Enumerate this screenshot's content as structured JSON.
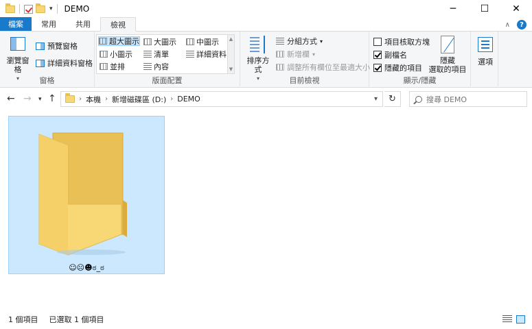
{
  "window": {
    "title": "DEMO",
    "controls": {
      "minimize": "─",
      "maximize": "☐",
      "close": "✕"
    }
  },
  "tabs": [
    {
      "label": "檔案",
      "kind": "file"
    },
    {
      "label": "常用",
      "kind": "normal"
    },
    {
      "label": "共用",
      "kind": "normal"
    },
    {
      "label": "檢視",
      "kind": "active"
    }
  ],
  "ribbon": {
    "panes": {
      "label": "窗格",
      "nav_pane": "瀏覽窗格",
      "preview_pane": "預覽窗格",
      "details_pane": "詳細資料窗格"
    },
    "layout": {
      "label": "版面配置",
      "items": [
        "超大圖示",
        "大圖示",
        "中圖示",
        "小圖示",
        "清單",
        "詳細資料",
        "並排",
        "內容"
      ],
      "selected": "超大圖示"
    },
    "current_view": {
      "label": "目前檢視",
      "sort_by": "排序方式",
      "group_by": "分組方式",
      "add_columns": "新增欄",
      "size_columns": "調整所有欄位至最適大小"
    },
    "show_hide": {
      "label": "顯示/隱藏",
      "item_checkboxes": {
        "label": "項目核取方塊",
        "checked": false
      },
      "file_extensions": {
        "label": "副檔名",
        "checked": true
      },
      "hidden_items": {
        "label": "隱藏的項目",
        "checked": true
      },
      "hide_selected_line1": "隱藏",
      "hide_selected_line2": "選取的項目"
    },
    "options": {
      "label": "選項"
    }
  },
  "address": {
    "path": [
      "本機",
      "新增磁碟區 (D:)",
      "DEMO"
    ],
    "search_placeholder": "搜尋 DEMO"
  },
  "files": [
    {
      "name": "☺☹☻ಠ_ಠ",
      "type": "folder",
      "selected": true
    }
  ],
  "status": {
    "item_count": "1 個項目",
    "selected_count": "已選取 1 個項目"
  },
  "colors": {
    "accent": "#1979ca",
    "selection_bg": "#cce8ff",
    "selection_border": "#99d1ff",
    "folder_front": "#f8d775",
    "folder_back": "#e8c055"
  }
}
